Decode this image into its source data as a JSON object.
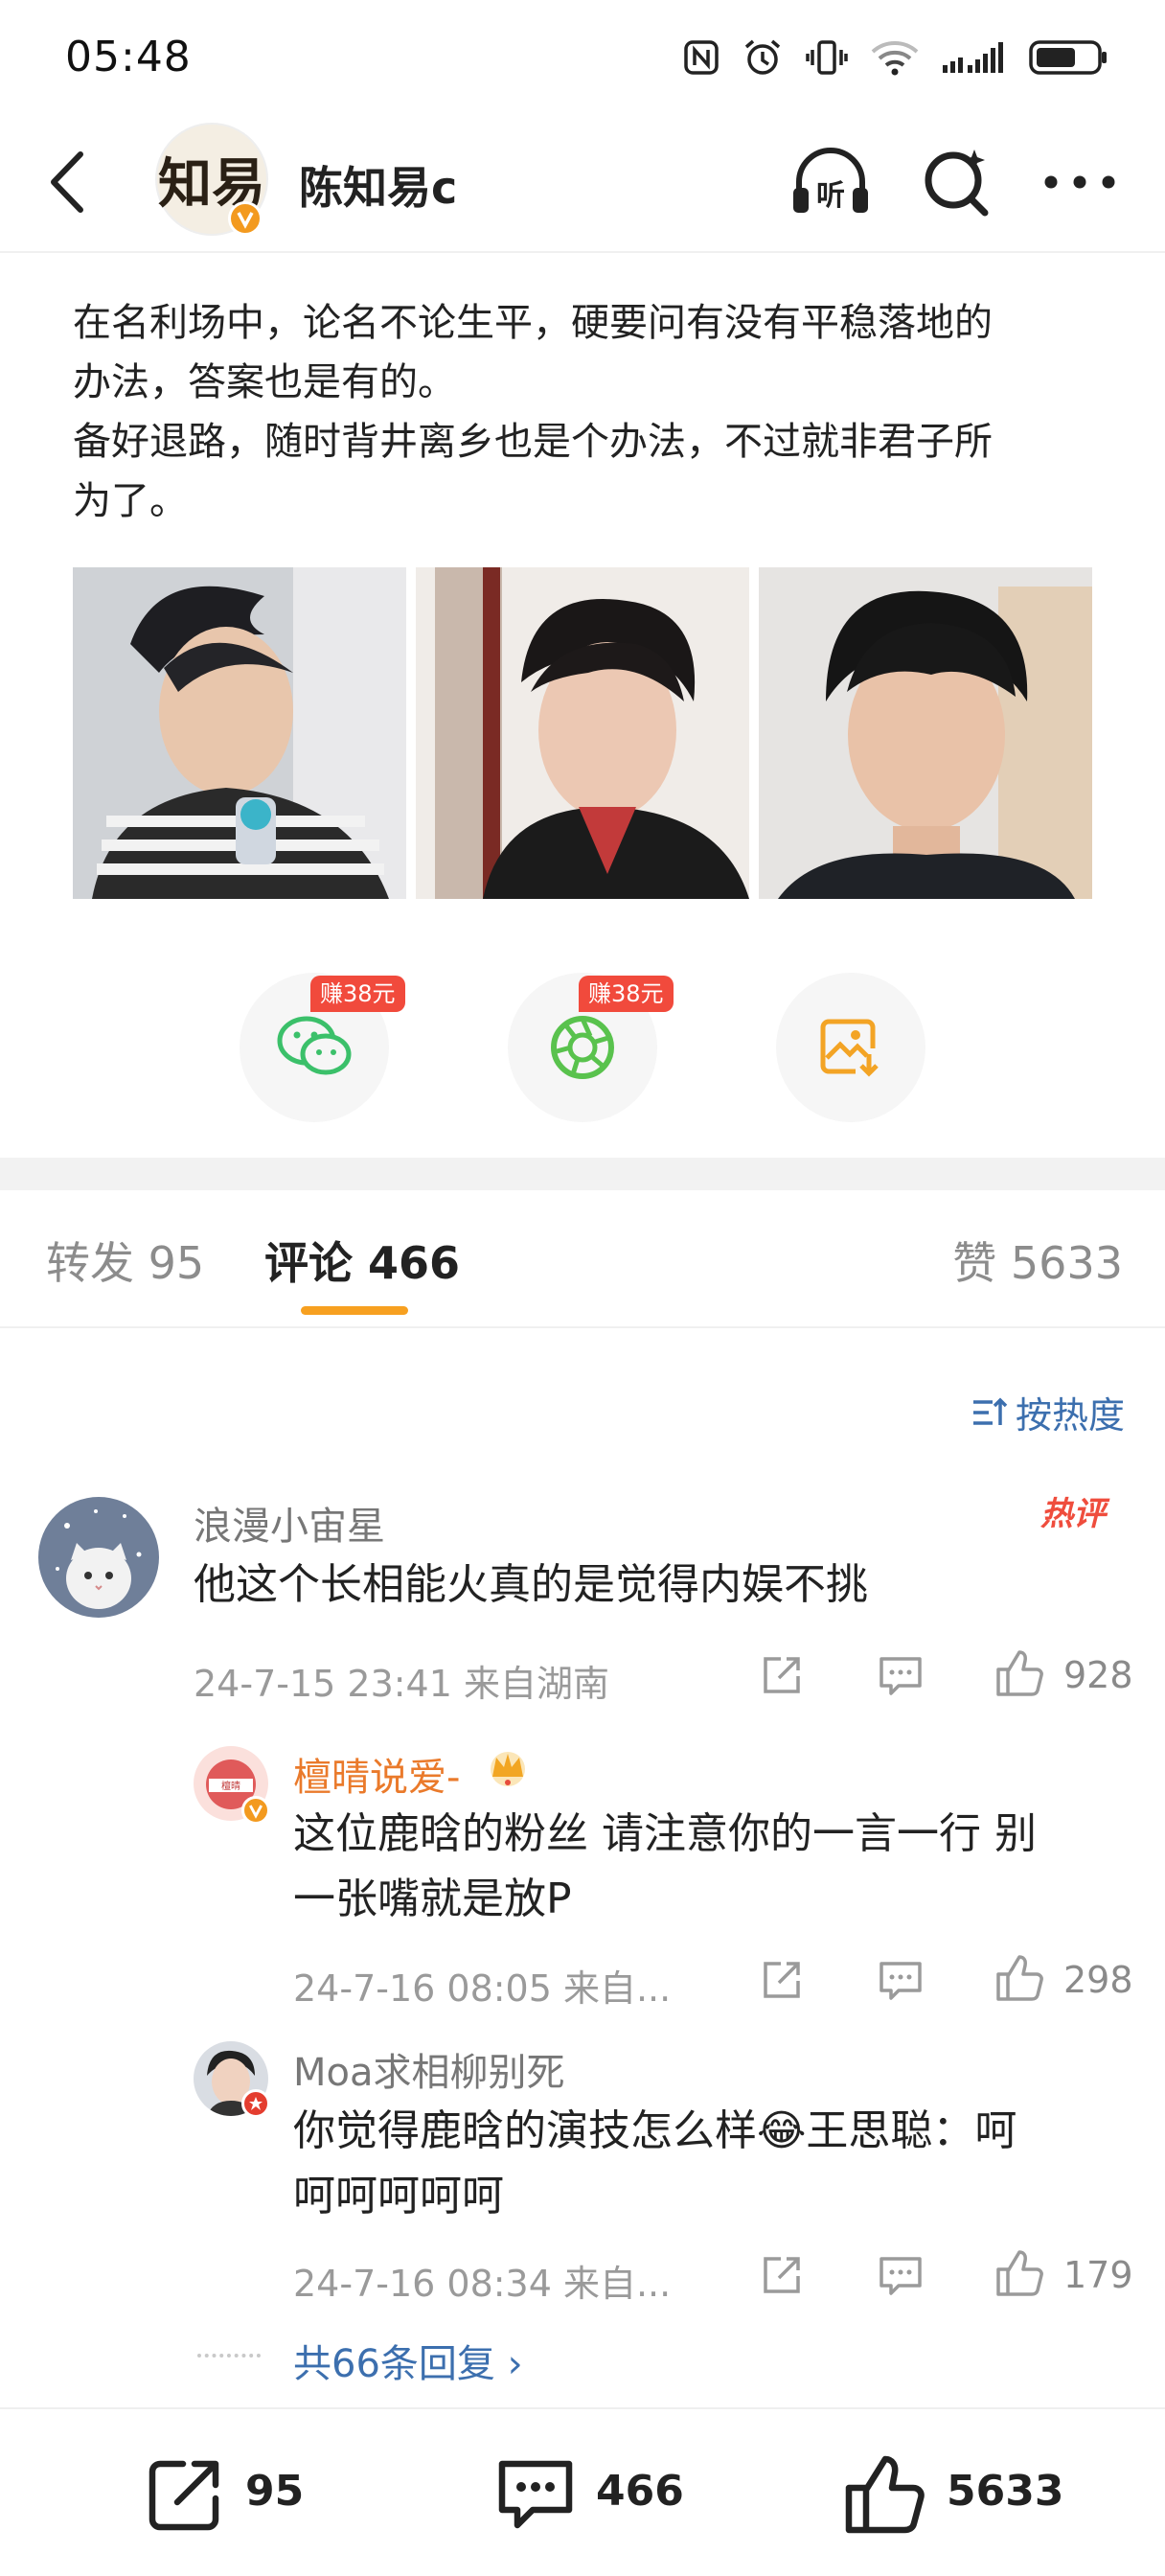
{
  "status_bar": {
    "time": "05:48"
  },
  "header": {
    "author": "陈知易c",
    "avatar_text": "知易"
  },
  "post": {
    "lines": [
      "在名利场中，论名不论生平，硬要问有没有平稳落地的",
      "办法，答案也是有的。",
      "备好退路，随时背井离乡也是个办法，不过就非君子所",
      "为了。"
    ]
  },
  "share": {
    "wechat_earn": "赚38元",
    "moments_earn": "赚38元"
  },
  "tabs": {
    "repost": "转发 95",
    "comment": "评论 466",
    "like": "赞 5633"
  },
  "sort_label": "按热度",
  "comments": [
    {
      "name": "浪漫小宙星",
      "badge": "热评",
      "text": "他这个长相能火真的是觉得内娱不挑",
      "meta": "24-7-15 23:41  来自湖南",
      "likes": "928"
    }
  ],
  "replies": [
    {
      "name": "檀晴说爱-",
      "text_lines": [
        "这位鹿晗的粉丝 请注意你的一言一行 别",
        "一张嘴就是放P"
      ],
      "meta": "24-7-16 08:05  来自...",
      "likes": "298"
    },
    {
      "name": "Moa求相柳别死",
      "text_lines": [
        "你觉得鹿晗的演技怎么样😂王思聪：呵",
        "呵呵呵呵呵"
      ],
      "meta": "24-7-16 08:34  来自...",
      "likes": "179"
    }
  ],
  "more_replies": "共66条回复 ›",
  "bottom_bar": {
    "repost_count": "95",
    "comment_count": "466",
    "like_count": "5633"
  },
  "colors": {
    "accent_orange": "#f7a020",
    "link_blue": "#3c6fae",
    "hot_red": "#ef4d3d",
    "earn_red": "#f14a3c"
  }
}
